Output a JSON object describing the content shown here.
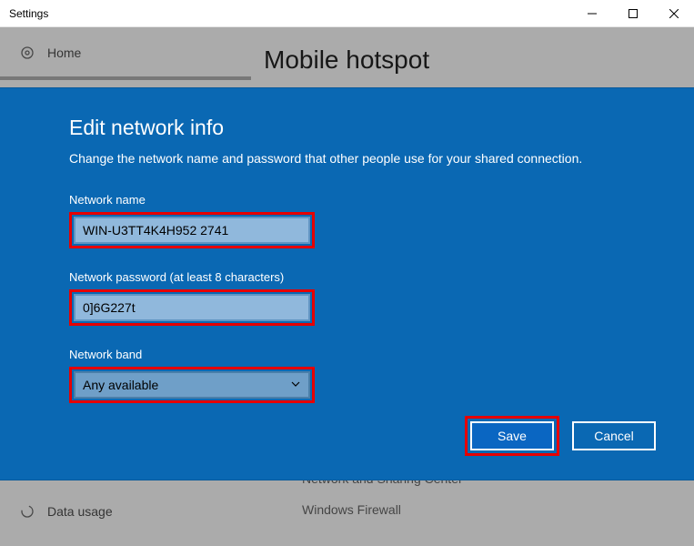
{
  "window": {
    "title": "Settings"
  },
  "sidebar": {
    "home_label": "Home",
    "data_usage_label": "Data usage"
  },
  "page": {
    "heading": "Mobile hotspot",
    "related": {
      "item1": "Network and Sharing Center",
      "item2": "Windows Firewall"
    }
  },
  "modal": {
    "title": "Edit network info",
    "description": "Change the network name and password that other people use for your shared connection.",
    "network_name": {
      "label": "Network name",
      "value": "WIN-U3TT4K4H952 2741"
    },
    "network_password": {
      "label": "Network password (at least 8 characters)",
      "value": "0]6G227t"
    },
    "network_band": {
      "label": "Network band",
      "value": "Any available"
    },
    "buttons": {
      "save": "Save",
      "cancel": "Cancel"
    }
  }
}
